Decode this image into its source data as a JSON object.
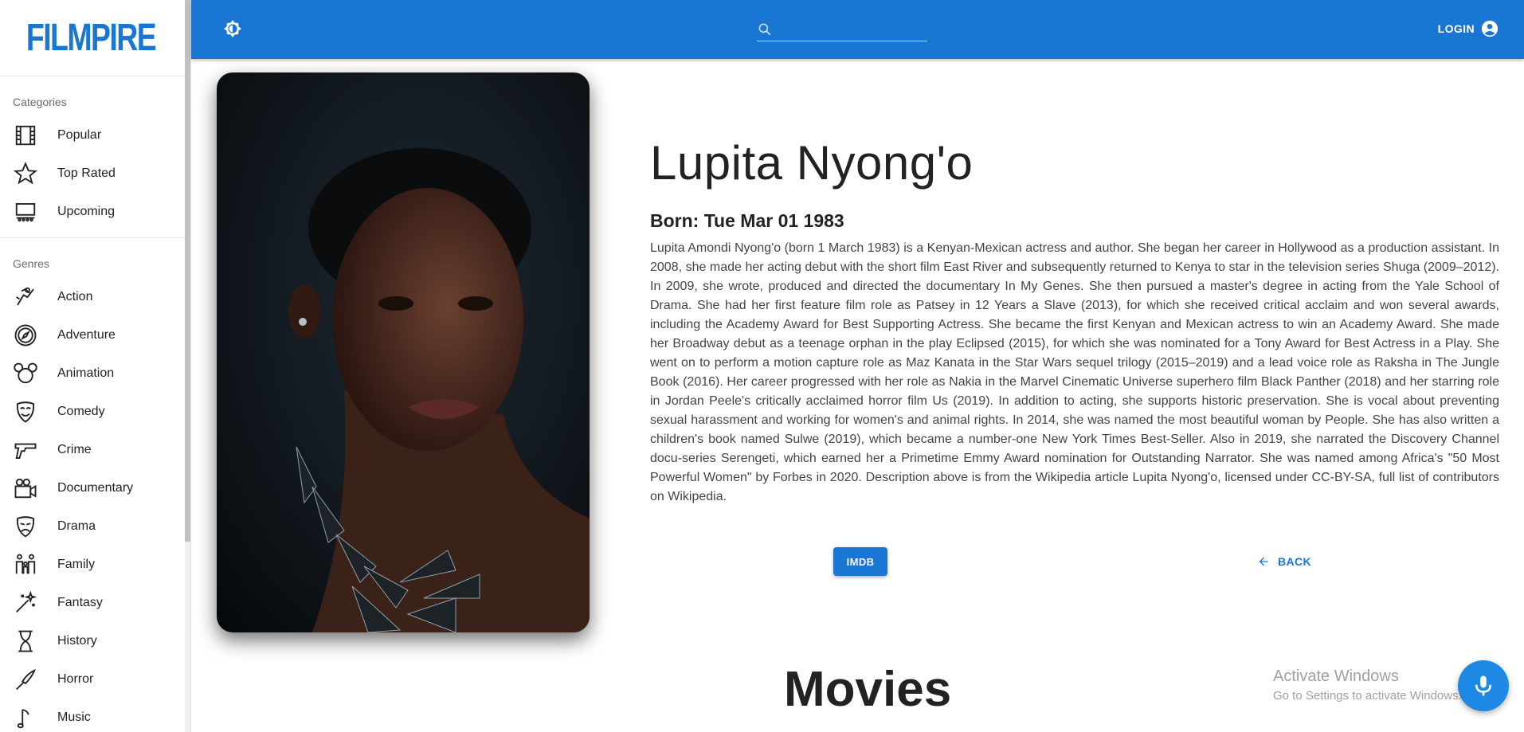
{
  "app": {
    "logo": "FILMPIRE"
  },
  "sidebar": {
    "categories_title": "Categories",
    "categories": [
      {
        "label": "Popular",
        "icon": "film-icon"
      },
      {
        "label": "Top Rated",
        "icon": "star-icon"
      },
      {
        "label": "Upcoming",
        "icon": "theater-icon"
      }
    ],
    "genres_title": "Genres",
    "genres": [
      {
        "label": "Action",
        "icon": "action-icon"
      },
      {
        "label": "Adventure",
        "icon": "compass-icon"
      },
      {
        "label": "Animation",
        "icon": "mouse-ears-icon"
      },
      {
        "label": "Comedy",
        "icon": "comedy-mask-icon"
      },
      {
        "label": "Crime",
        "icon": "gun-icon"
      },
      {
        "label": "Documentary",
        "icon": "camera-icon"
      },
      {
        "label": "Drama",
        "icon": "drama-mask-icon"
      },
      {
        "label": "Family",
        "icon": "family-icon"
      },
      {
        "label": "Fantasy",
        "icon": "magic-wand-icon"
      },
      {
        "label": "History",
        "icon": "hourglass-icon"
      },
      {
        "label": "Horror",
        "icon": "knife-icon"
      },
      {
        "label": "Music",
        "icon": "music-icon"
      }
    ]
  },
  "topbar": {
    "search_placeholder": "",
    "login_label": "LOGIN"
  },
  "actor": {
    "name": "Lupita Nyong'o",
    "born": "Born: Tue Mar 01 1983",
    "biography": "Lupita Amondi Nyong'o (born 1 March 1983) is a Kenyan-Mexican actress and author. She began her career in Hollywood as a production assistant. In 2008, she made her acting debut with the short film East River and subsequently returned to Kenya to star in the television series Shuga (2009–2012). In 2009, she wrote, produced and directed the documentary In My Genes. She then pursued a master's degree in acting from the Yale School of Drama. She had her first feature film role as Patsey in 12 Years a Slave (2013), for which she received critical acclaim and won several awards, including the Academy Award for Best Supporting Actress. She became the first Kenyan and Mexican actress to win an Academy Award. She made her Broadway debut as a teenage orphan in the play Eclipsed (2015), for which she was nominated for a Tony Award for Best Actress in a Play. She went on to perform a motion capture role as Maz Kanata in the Star Wars sequel trilogy (2015–2019) and a lead voice role as Raksha in The Jungle Book (2016). Her career progressed with her role as Nakia in the Marvel Cinematic Universe superhero film Black Panther (2018) and her starring role in Jordan Peele's critically acclaimed horror film Us (2019). In addition to acting, she supports historic preservation. She is vocal about preventing sexual harassment and working for women's and animal rights. In 2014, she was named the most beautiful woman by People. She has also written a children's book named Sulwe (2019), which became a number-one New York Times Best-Seller. Also in 2019, she narrated the Discovery Channel docu-series Serengeti, which earned her a Primetime Emmy Award nomination for Outstanding Narrator. She was named among Africa's \"50 Most Powerful Women\" by Forbes in 2020. Description above is from the Wikipedia article Lupita Nyong'o, licensed under CC-BY-SA, full list of contributors on Wikipedia.",
    "imdb_label": "IMDB",
    "back_label": "BACK"
  },
  "movies_heading": "Movies",
  "os_overlay": {
    "line1": "Activate Windows",
    "line2": "Go to Settings to activate Windows."
  },
  "colors": {
    "primary": "#1976d2",
    "mic": "#1e88e5"
  }
}
